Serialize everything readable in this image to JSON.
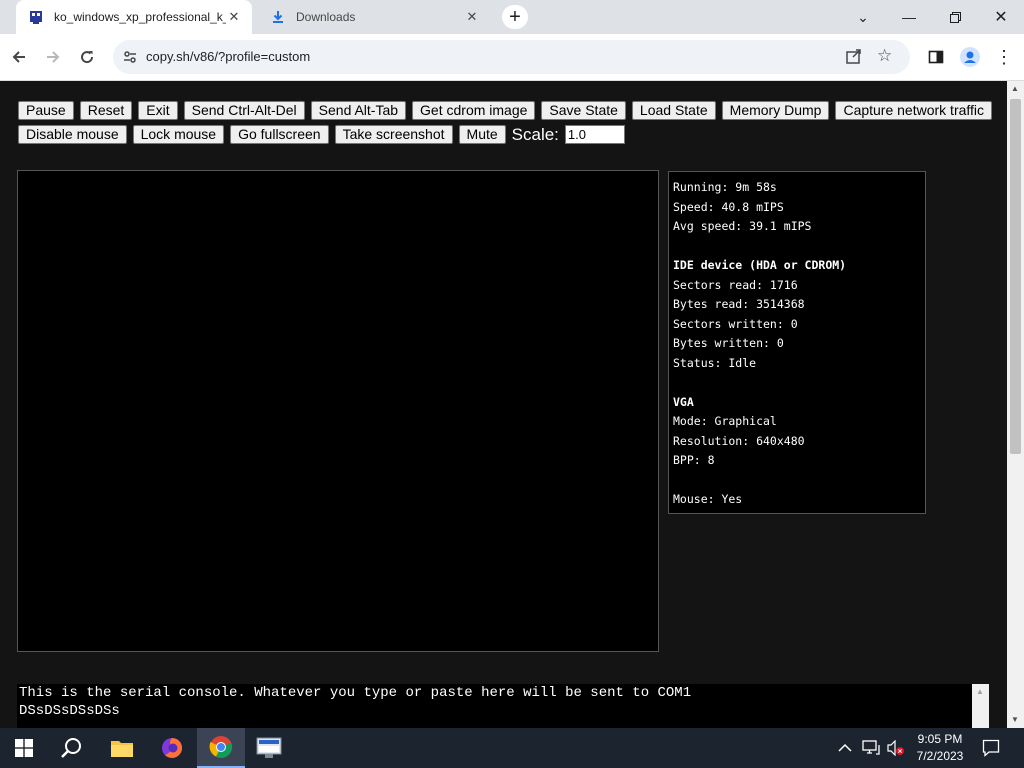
{
  "browser": {
    "tabs": [
      {
        "title": "ko_windows_xp_professional_k_",
        "active": true
      },
      {
        "title": "Downloads",
        "active": false
      }
    ],
    "address": "copy.sh/v86/?profile=custom"
  },
  "controls": {
    "row1": [
      "Pause",
      "Reset",
      "Exit",
      "Send Ctrl-Alt-Del",
      "Send Alt-Tab",
      "Get cdrom image",
      "Save State",
      "Load State",
      "Memory Dump",
      "Capture network traffic"
    ],
    "row2": [
      "Disable mouse",
      "Lock mouse",
      "Go fullscreen",
      "Take screenshot",
      "Mute"
    ],
    "scale_label": "Scale:",
    "scale_value": "1.0"
  },
  "stats": {
    "running": "Running: 9m 58s",
    "speed": "Speed: 40.8 mIPS",
    "avg_speed": "Avg speed: 39.1 mIPS",
    "ide_header": "IDE device (HDA or CDROM)",
    "sectors_read": "Sectors read: 1716",
    "bytes_read": "Bytes read: 3514368",
    "sectors_written": "Sectors written: 0",
    "bytes_written": "Bytes written: 0",
    "status": "Status: Idle",
    "vga_header": "VGA",
    "mode": "Mode: Graphical",
    "resolution": "Resolution: 640x480",
    "bpp": "BPP: 8",
    "mouse": "Mouse: Yes"
  },
  "serial": {
    "line1": "This is the serial console. Whatever you type or paste here will be sent to COM1",
    "line2": "DSsDSsDSsDSs"
  },
  "taskbar": {
    "time": "9:05 PM",
    "date": "7/2/2023"
  }
}
